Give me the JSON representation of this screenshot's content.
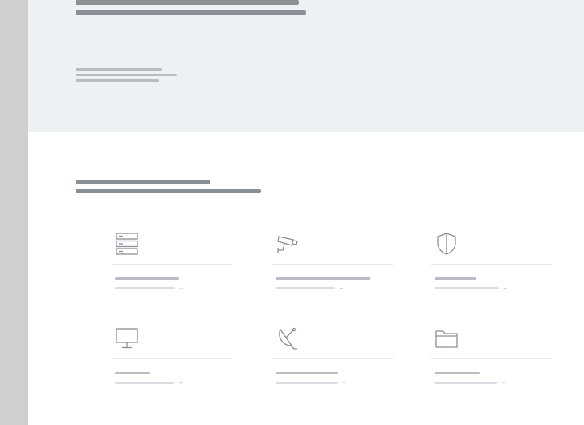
{
  "hero": {
    "title_lines": [
      "",
      ""
    ],
    "note_lines": [
      "",
      "",
      ""
    ]
  },
  "section": {
    "title_lines": [
      "",
      ""
    ]
  },
  "cards": [
    {
      "icon": "server-icon",
      "title": "",
      "link_label": "",
      "arrow": "→"
    },
    {
      "icon": "cctv-camera-icon",
      "title": "",
      "link_label": "",
      "arrow": "→"
    },
    {
      "icon": "shield-icon",
      "title": "",
      "link_label": "",
      "arrow": "→"
    },
    {
      "icon": "monitor-icon",
      "title": "",
      "link_label": "",
      "arrow": "→"
    },
    {
      "icon": "satellite-dish-icon",
      "title": "",
      "link_label": "",
      "arrow": "→"
    },
    {
      "icon": "folder-icon",
      "title": "",
      "link_label": "",
      "arrow": "→"
    }
  ],
  "colors": {
    "page_background": "#ffffff",
    "hero_background": "#eef1f4",
    "left_strip": "#cfcfcf",
    "icon_stroke": "#8a8f96",
    "divider": "#e3e5e8"
  }
}
